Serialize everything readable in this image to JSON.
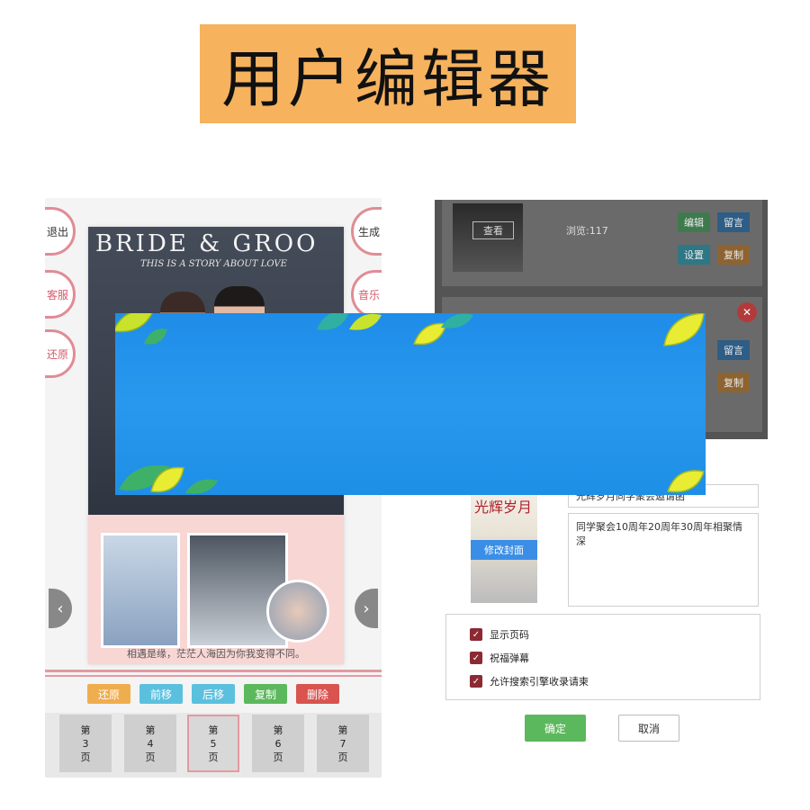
{
  "header": {
    "title": "用户编辑器"
  },
  "editor": {
    "side_left": [
      "退出",
      "客服",
      "还原"
    ],
    "side_right": [
      "生成",
      "音乐"
    ],
    "card": {
      "chalk_title": "BRIDE & GROO",
      "chalk_subtitle": "THIS IS A STORY ABOUT LOVE",
      "caption": "相遇是缘，茫茫人海因为你我变得不同。"
    },
    "nav": {
      "prev": "‹",
      "next": "›"
    },
    "tools": [
      "还原",
      "前移",
      "后移",
      "复制",
      "删除"
    ],
    "pages": [
      {
        "top": "第",
        "num": "3",
        "bottom": "页"
      },
      {
        "top": "第",
        "num": "4",
        "bottom": "页"
      },
      {
        "top": "第",
        "num": "5",
        "bottom": "页"
      },
      {
        "top": "第",
        "num": "6",
        "bottom": "页"
      },
      {
        "top": "第",
        "num": "7",
        "bottom": "页"
      }
    ],
    "active_page": "5"
  },
  "admin": {
    "list": {
      "view_tag": "查看",
      "views": "浏览:117",
      "buttons": [
        "编辑",
        "留言",
        "设置",
        "复制"
      ],
      "buttons2": [
        "留言",
        "复制"
      ],
      "close": "✕"
    },
    "form": {
      "cover_calligraphy": "光辉岁月",
      "edit_cover": "修改封面",
      "title_value": "光辉岁月同学聚会邀请函",
      "desc_value": "同学聚会10周年20周年30周年相聚情深",
      "options": [
        "显示页码",
        "祝福弹幕",
        "允许搜索引擎收录请柬"
      ],
      "ok": "确定",
      "cancel": "取消"
    }
  },
  "colors": {
    "banner": "#f6b25d",
    "accent_pink": "#e39aa1",
    "overlay_blue": "#1f8de8"
  }
}
